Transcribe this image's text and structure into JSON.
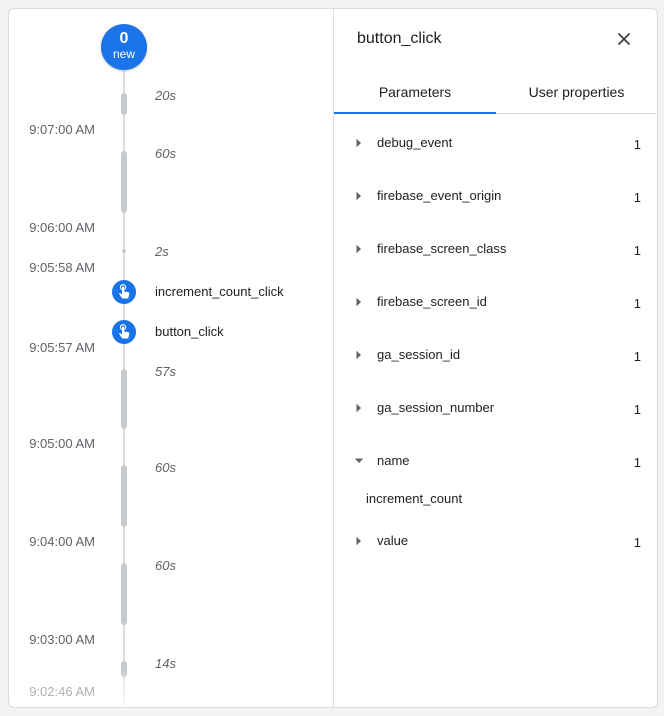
{
  "timeline": {
    "new_badge": {
      "count": "0",
      "label": "new"
    },
    "times": [
      "9:07:00 AM",
      "9:06:00 AM",
      "9:05:58 AM",
      "9:05:57 AM",
      "9:05:00 AM",
      "9:04:00 AM",
      "9:03:00 AM",
      "9:02:46 AM"
    ],
    "durations": [
      "20s",
      "60s",
      "2s",
      "57s",
      "60s",
      "60s",
      "14s"
    ],
    "events": [
      {
        "label": "increment_count_click",
        "icon": "touch-icon"
      },
      {
        "label": "button_click",
        "icon": "touch-icon"
      }
    ]
  },
  "detail": {
    "title": "button_click",
    "close_icon": "close-icon",
    "tabs": [
      "Parameters",
      "User properties"
    ],
    "active_tab": "Parameters",
    "params": [
      {
        "name": "debug_event",
        "count": "1",
        "expanded": false
      },
      {
        "name": "firebase_event_origin",
        "count": "1",
        "expanded": false
      },
      {
        "name": "firebase_screen_class",
        "count": "1",
        "expanded": false
      },
      {
        "name": "firebase_screen_id",
        "count": "1",
        "expanded": false
      },
      {
        "name": "ga_session_id",
        "count": "1",
        "expanded": false
      },
      {
        "name": "ga_session_number",
        "count": "1",
        "expanded": false
      },
      {
        "name": "name",
        "count": "1",
        "expanded": true,
        "value": "increment_count"
      },
      {
        "name": "value",
        "count": "1",
        "expanded": false
      }
    ]
  },
  "colors": {
    "accent": "#1a73e8",
    "segment": "#c7cacd",
    "muted_text": "#5f6368"
  }
}
